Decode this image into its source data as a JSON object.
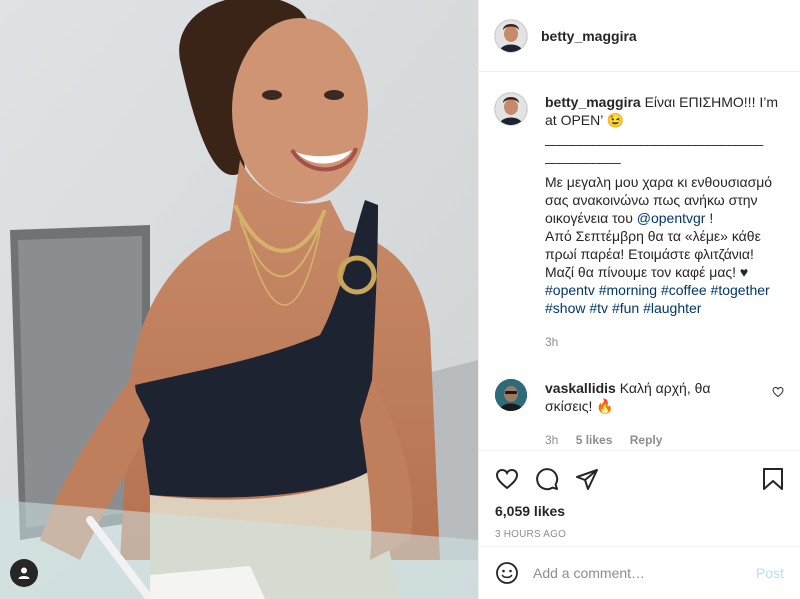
{
  "post": {
    "username": "betty_maggira",
    "caption_intro": "Είναι ΕΠΙΣΗΜΟ!!! I’m at OPEN’ 😉",
    "caption_divider": "________________________________",
    "caption_divider2": "___________",
    "caption_lines": [
      "Με μεγαλη μου χαρα κι ενθουσιασμό σας ανακοινώνω πως ανήκω στην οικογένεια του",
      "Από Σεπτέμβρη θα τα «λέμε» κάθε πρωί παρέα! Ετοιμάστε φλιτζάνια! Μαζί θα πίνουμε τον καφέ μας! ♥"
    ],
    "mention": "@opentvgr",
    "mention_suffix": " !",
    "hashtags": [
      "#opentv",
      "#morning",
      "#coffee",
      "#together",
      "#show",
      "#tv",
      "#fun",
      "#laughter"
    ],
    "caption_age": "3h"
  },
  "comment": {
    "username": "vaskallidis",
    "text": "Καλή αρχή, θα σκίσεις! 🔥",
    "age": "3h",
    "likes": "5 likes",
    "reply_label": "Reply"
  },
  "likes_label": "6,059 likes",
  "timestamp": "3 HOURS AGO",
  "add_comment": {
    "placeholder": "Add a comment…",
    "post_label": "Post"
  },
  "icons": {
    "like": "heart-icon",
    "comment": "comment-icon",
    "share": "share-icon",
    "save": "bookmark-icon",
    "emoji": "emoji-icon",
    "tag": "user-tag-icon"
  },
  "colors": {
    "link": "#00376b",
    "muted": "#8e8e8e",
    "post_disabled": "#b2dffc"
  }
}
